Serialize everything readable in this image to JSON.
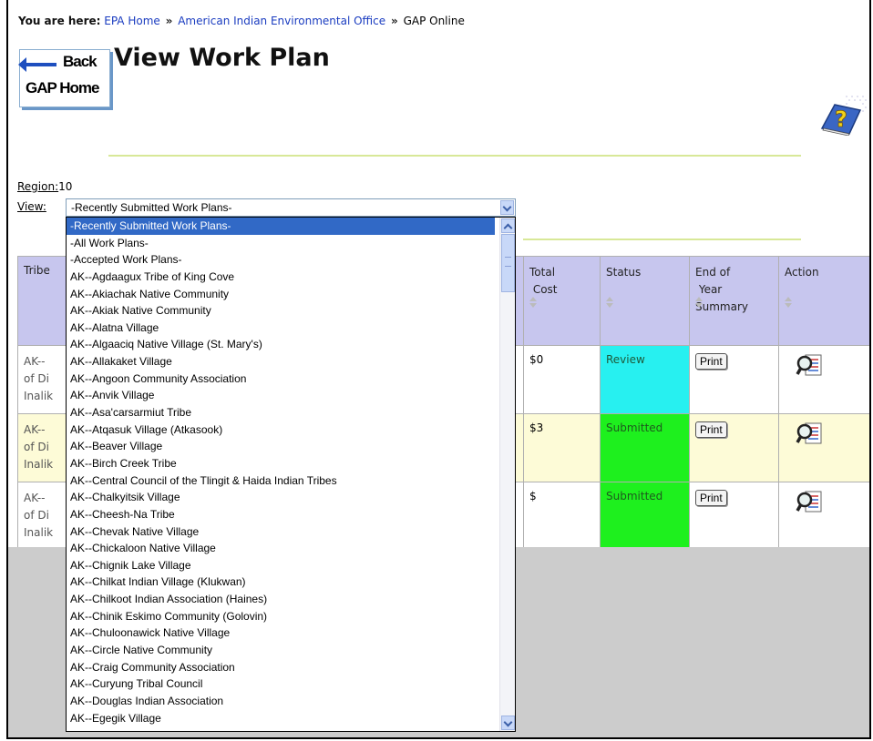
{
  "breadcrumb": {
    "prefix": "You are here:",
    "links": [
      "EPA Home",
      "American Indian Environmental Office"
    ],
    "separator": "»",
    "current": "GAP Online"
  },
  "back_button": {
    "back_label": "Back",
    "home_label": "GAP Home"
  },
  "page_title": "View Work Plan",
  "help_icon": "help-question-icon",
  "filters": {
    "region_label": "Region:",
    "region_value": "10",
    "view_label": "View:",
    "view_selected": "-Recently Submitted Work Plans-"
  },
  "view_options": [
    "-Recently Submitted Work Plans-",
    "-All Work Plans-",
    "-Accepted Work Plans-",
    "AK--Agdaagux Tribe of King Cove",
    "AK--Akiachak Native Community",
    "AK--Akiak Native Community",
    "AK--Alatna Village",
    "AK--Algaaciq Native Village (St. Mary's)",
    "AK--Allakaket Village",
    "AK--Angoon Community Association",
    "AK--Anvik Village",
    "AK--Asa'carsarmiut Tribe",
    "AK--Atqasuk Village (Atkasook)",
    "AK--Beaver Village",
    "AK--Birch Creek Tribe",
    "AK--Central Council of the Tlingit & Haida Indian Tribes",
    "AK--Chalkyitsik Village",
    "AK--Cheesh-Na Tribe",
    "AK--Chevak Native Village",
    "AK--Chickaloon Native Village",
    "AK--Chignik Lake Village",
    "AK--Chilkat Indian Village (Klukwan)",
    "AK--Chilkoot Indian Association (Haines)",
    "AK--Chinik Eskimo Community (Golovin)",
    "AK--Chuloonawick Native Village",
    "AK--Circle Native Community",
    "AK--Craig Community Association",
    "AK--Curyung Tribal Council",
    "AK--Douglas Indian Association",
    "AK--Egegik Village"
  ],
  "table": {
    "columns": {
      "tribe": "Tribe",
      "total_cost": [
        "Total",
        "Cost"
      ],
      "status": "Status",
      "eoy": [
        "End of",
        "Year",
        "Summary"
      ],
      "action": "Action"
    },
    "rows": [
      {
        "tribe_lines": [
          "AK--",
          "of Di",
          "Inalik"
        ],
        "cost": "$0",
        "status": "Review",
        "print": "Print"
      },
      {
        "tribe_lines": [
          "AK--",
          "of Di",
          "Inalik"
        ],
        "cost": "$3",
        "status": "Submitted",
        "print": "Print"
      },
      {
        "tribe_lines": [
          "AK--",
          "of Di",
          "Inalik"
        ],
        "cost": "$",
        "status": "Submitted",
        "print": "Print"
      }
    ]
  },
  "colors": {
    "header_bg": "#c7c6ee",
    "row_alt_bg": "#fdfbd7",
    "status_review": "#27f0f0",
    "status_submitted": "#1ef01e",
    "select_highlight": "#3169c6",
    "link": "#1a3cc0"
  }
}
